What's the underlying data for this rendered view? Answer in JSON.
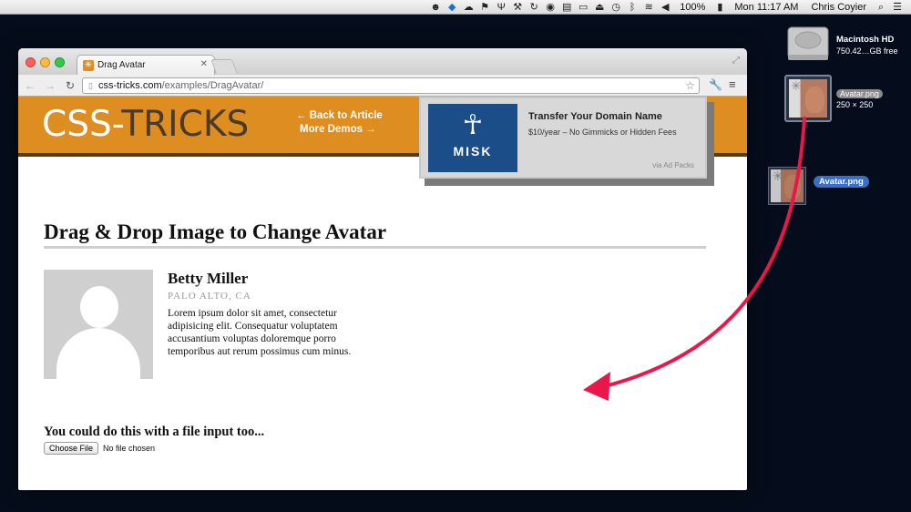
{
  "menubar": {
    "battery": "100%",
    "clock": "Mon 11:17 AM",
    "user": "Chris Coyier",
    "icons": [
      "alien-icon",
      "dropbox-icon",
      "cloud-icon",
      "flag-icon",
      "fork-icon",
      "tool-icon",
      "refresh-icon",
      "circle-icon",
      "keyboard-icon",
      "screen-icon",
      "airplay-icon",
      "timemachine-icon",
      "bluetooth-icon",
      "wifi-icon",
      "volume-icon",
      "battery-icon",
      "search-icon",
      "list-icon"
    ]
  },
  "desktop": {
    "hd_name": "Macintosh HD",
    "hd_free": "750.42…GB free",
    "file_name": "Avatar.png",
    "file_dims": "250 × 250",
    "drag_label": "Avatar.png"
  },
  "browser": {
    "tab_title": "Drag Avatar",
    "url_host": "css-tricks.com",
    "url_path": "/examples/DragAvatar/"
  },
  "page": {
    "logo_part1": "CSS-",
    "logo_part2": "TRICKS",
    "link_back": "← Back to Article",
    "link_more": "More Demos →",
    "ad": {
      "logo_text": "MISK",
      "title": "Transfer Your Domain Name",
      "subtitle": "$10/year – No Gimmicks or Hidden Fees",
      "via": "via Ad Packs"
    },
    "heading": "Drag & Drop Image to Change Avatar",
    "person": {
      "name": "Betty Miller",
      "location": "PALO ALTO, CA",
      "bio": "Lorem ipsum dolor sit amet, consectetur adipisicing elit. Consequatur voluptatem accusantium voluptas doloremque porro temporibus aut rerum possimus cum minus."
    },
    "file_heading": "You could do this with a file input too...",
    "file_button": "Choose File",
    "file_status": "No file chosen"
  },
  "colors": {
    "header_orange": "#de8d20",
    "arrow": "#e8184b",
    "ad_blue": "#1b4e88"
  }
}
